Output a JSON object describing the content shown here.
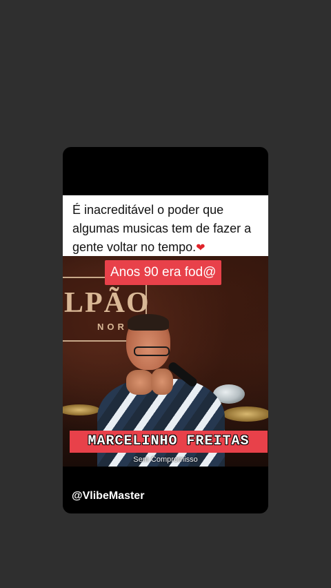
{
  "post": {
    "caption": "É inacreditável o poder que algumas musicas tem de fazer a gente voltar no tempo.",
    "caption_emoji": "❤",
    "overlay_top": "Anos 90 era fod@",
    "artist_name": "MARCELINHO FREITAS",
    "song_title": "Sem Compromisso",
    "watermark": "@VlibeMaster",
    "stage_sign": "LPÃO",
    "stage_sign_sub": "NORTE"
  },
  "colors": {
    "background": "#2f2f2f",
    "card": "#000000",
    "tag_red": "#e8414a",
    "heart": "#e0242b"
  }
}
